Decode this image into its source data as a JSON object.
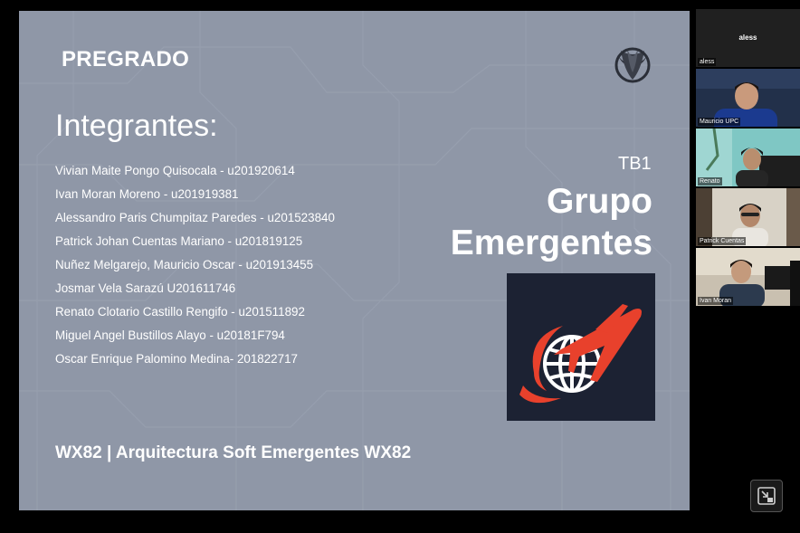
{
  "slide": {
    "label": "PREGRADO",
    "heading": "Integrantes:",
    "members": [
      "Vivian Maite Pongo Quisocala - u201920614",
      "Ivan Moran Moreno - u201919381",
      "Alessandro Paris Chumpitaz Paredes - u201523840",
      "Patrick Johan Cuentas Mariano - u201819125",
      "Nuñez Melgarejo, Mauricio Oscar - u201913455",
      "Josmar Vela Sarazú  U201611746",
      "Renato Clotario Castillo Rengifo - u201511892",
      "Miguel Angel Bustillos Alayo - u20181F794",
      "Oscar Enrique Palomino Medina- 201822717"
    ],
    "tb": "TB1",
    "group_line1": "Grupo",
    "group_line2": "Emergentes",
    "footer": "WX82 | Arquitectura Soft Emergentes WX82",
    "logo_icon": "plane-globe-logo-icon",
    "university_icon": "upc-logo-icon"
  },
  "participants": [
    {
      "name": "aless",
      "center_label": "aless",
      "camera": false
    },
    {
      "name": "Mauricio UPC",
      "camera": true
    },
    {
      "name": "Renato",
      "camera": true
    },
    {
      "name": "Patrick Cuentas",
      "camera": true
    },
    {
      "name": "Ivan Moran",
      "camera": true
    }
  ],
  "controls": {
    "exit_fullscreen_icon": "exit-fullscreen-icon"
  },
  "colors": {
    "slide_bg": "#8f97a7",
    "logo_bg": "#1c2233",
    "logo_red": "#e8412c"
  }
}
